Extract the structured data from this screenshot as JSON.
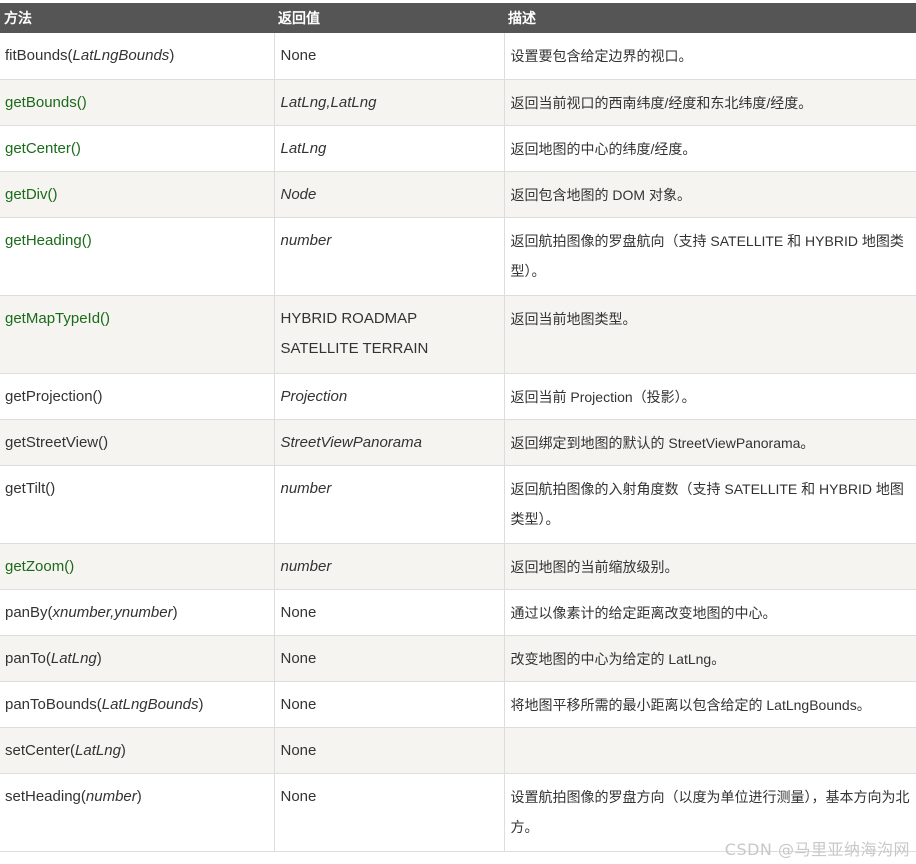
{
  "header": {
    "col_method": "方法",
    "col_return": "返回值",
    "col_desc": "描述"
  },
  "rows": [
    {
      "name": "fitBounds(",
      "arg": "LatLngBounds",
      "close": ")",
      "ret": "None",
      "ret_italic": false,
      "desc": "设置要包含给定边界的视口。",
      "green": false
    },
    {
      "name": "getBounds()",
      "arg": "",
      "close": "",
      "ret": "LatLng,LatLng",
      "ret_italic": true,
      "desc": "返回当前视口的西南纬度/经度和东北纬度/经度。",
      "green": true
    },
    {
      "name": "getCenter()",
      "arg": "",
      "close": "",
      "ret": "LatLng",
      "ret_italic": true,
      "desc": "返回地图的中心的纬度/经度。",
      "green": true
    },
    {
      "name": "getDiv()",
      "arg": "",
      "close": "",
      "ret": "Node",
      "ret_italic": true,
      "desc": "返回包含地图的 DOM 对象。",
      "green": true
    },
    {
      "name": "getHeading()",
      "arg": "",
      "close": "",
      "ret": "number",
      "ret_italic": true,
      "desc": "返回航拍图像的罗盘航向（支持 SATELLITE 和 HYBRID 地图类型）。",
      "green": true
    },
    {
      "name": "getMapTypeId()",
      "arg": "",
      "close": "",
      "ret": "HYBRID ROADMAP SATELLITE TERRAIN",
      "ret_italic": false,
      "desc": "返回当前地图类型。",
      "green": true
    },
    {
      "name": "getProjection()",
      "arg": "",
      "close": "",
      "ret": "Projection",
      "ret_italic": true,
      "desc": "返回当前 Projection（投影）。",
      "green": false
    },
    {
      "name": "getStreetView()",
      "arg": "",
      "close": "",
      "ret": "StreetViewPanorama",
      "ret_italic": true,
      "desc": "返回绑定到地图的默认的 StreetViewPanorama。",
      "green": false
    },
    {
      "name": "getTilt()",
      "arg": "",
      "close": "",
      "ret": "number",
      "ret_italic": true,
      "desc": "返回航拍图像的入射角度数（支持 SATELLITE 和 HYBRID 地图类型）。",
      "green": false
    },
    {
      "name": "getZoom()",
      "arg": "",
      "close": "",
      "ret": "number",
      "ret_italic": true,
      "desc": "返回地图的当前缩放级别。",
      "green": true
    },
    {
      "name": "panBy(",
      "arg": "xnumber,ynumber",
      "close": ")",
      "ret": "None",
      "ret_italic": false,
      "desc": "通过以像素计的给定距离改变地图的中心。",
      "green": false
    },
    {
      "name": "panTo(",
      "arg": "LatLng",
      "close": ")",
      "ret": "None",
      "ret_italic": false,
      "desc": "改变地图的中心为给定的 LatLng。",
      "green": false
    },
    {
      "name": "panToBounds(",
      "arg": "LatLngBounds",
      "close": ")",
      "ret": "None",
      "ret_italic": false,
      "desc": "将地图平移所需的最小距离以包含给定的 LatLngBounds。",
      "green": false
    },
    {
      "name": "setCenter(",
      "arg": "LatLng",
      "close": ")",
      "ret": "None",
      "ret_italic": false,
      "desc": "",
      "green": false
    },
    {
      "name": "setHeading(",
      "arg": "number",
      "close": ")",
      "ret": "None",
      "ret_italic": false,
      "desc": "设置航拍图像的罗盘方向（以度为单位进行测量），基本方向为北方。",
      "green": false
    }
  ],
  "watermark": "CSDN @马里亚纳海沟网"
}
